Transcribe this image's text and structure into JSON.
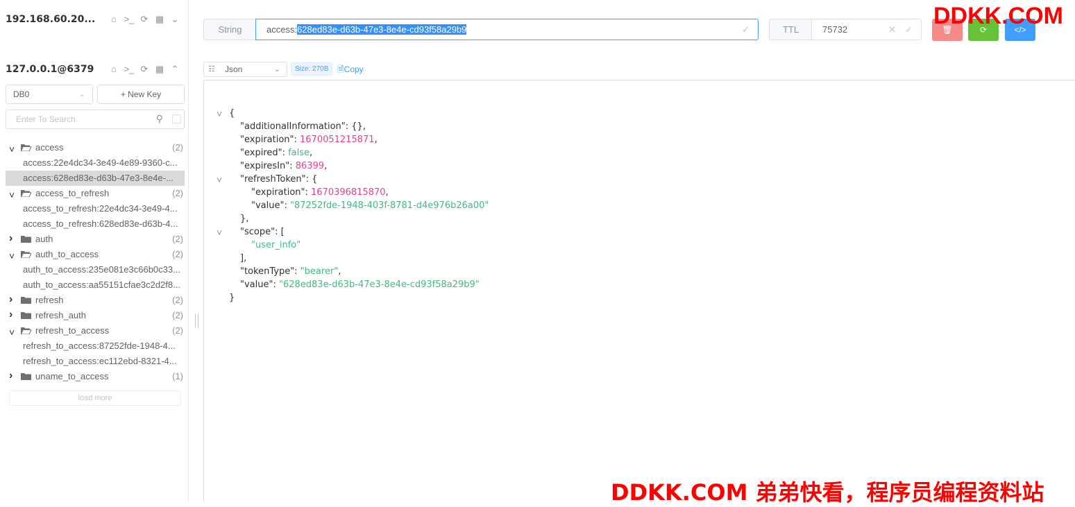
{
  "connections": [
    {
      "name": "192.168.60.20...",
      "icons": [
        "home-icon",
        "terminal-icon",
        "refresh-icon",
        "grid-icon",
        "chevron-down-icon"
      ]
    },
    {
      "name": "127.0.0.1@6379",
      "icons": [
        "home-icon",
        "terminal-icon",
        "refresh-icon",
        "grid-icon",
        "chevron-up-icon"
      ]
    }
  ],
  "sidebar": {
    "db": "DB0",
    "new_key": "+ New Key",
    "search_placeholder": "Enter To Search",
    "load_more": "load more",
    "tree": [
      {
        "type": "folder",
        "label": "access",
        "count": "(2)",
        "open": true
      },
      {
        "type": "leaf",
        "label": "access:22e4dc34-3e49-4e89-9360-c..."
      },
      {
        "type": "leaf",
        "label": "access:628ed83e-d63b-47e3-8e4e-...",
        "selected": true
      },
      {
        "type": "folder",
        "label": "access_to_refresh",
        "count": "(2)",
        "open": true
      },
      {
        "type": "leaf",
        "label": "access_to_refresh:22e4dc34-3e49-4..."
      },
      {
        "type": "leaf",
        "label": "access_to_refresh:628ed83e-d63b-4..."
      },
      {
        "type": "folder",
        "label": "auth",
        "count": "(2)",
        "open": false
      },
      {
        "type": "folder",
        "label": "auth_to_access",
        "count": "(2)",
        "open": true
      },
      {
        "type": "leaf",
        "label": "auth_to_access:235e081e3c66b0c33..."
      },
      {
        "type": "leaf",
        "label": "auth_to_access:aa55151cfae3c2d2f8..."
      },
      {
        "type": "folder",
        "label": "refresh",
        "count": "(2)",
        "open": false
      },
      {
        "type": "folder",
        "label": "refresh_auth",
        "count": "(2)",
        "open": false
      },
      {
        "type": "folder",
        "label": "refresh_to_access",
        "count": "(2)",
        "open": true
      },
      {
        "type": "leaf",
        "label": "refresh_to_access:87252fde-1948-4..."
      },
      {
        "type": "leaf",
        "label": "refresh_to_access:ec112ebd-8321-4..."
      },
      {
        "type": "folder",
        "label": "uname_to_access",
        "count": "(1)",
        "open": false
      }
    ]
  },
  "key_bar": {
    "type": "String",
    "key_prefix": "access:",
    "key_selected": "628ed83e-d63b-47e3-8e4e-cd93f58a29b9",
    "ttl_label": "TTL",
    "ttl_value": "75732"
  },
  "value_bar": {
    "format": "Json",
    "size": "Size: 270B",
    "copy": "Copy"
  },
  "json_lines": [
    {
      "indent": 0,
      "fold": true,
      "parts": [
        {
          "t": "p",
          "v": "{"
        }
      ]
    },
    {
      "indent": 1,
      "parts": [
        {
          "t": "p",
          "v": "\"additionalInformation\": {},"
        }
      ]
    },
    {
      "indent": 1,
      "parts": [
        {
          "t": "p",
          "v": "\"expiration\": "
        },
        {
          "t": "num",
          "v": "1670051215871"
        },
        {
          "t": "p",
          "v": ","
        }
      ]
    },
    {
      "indent": 1,
      "parts": [
        {
          "t": "p",
          "v": "\"expired\": "
        },
        {
          "t": "bool",
          "v": "false"
        },
        {
          "t": "p",
          "v": ","
        }
      ]
    },
    {
      "indent": 1,
      "parts": [
        {
          "t": "p",
          "v": "\"expiresIn\": "
        },
        {
          "t": "num",
          "v": "86399"
        },
        {
          "t": "p",
          "v": ","
        }
      ]
    },
    {
      "indent": 1,
      "fold": true,
      "parts": [
        {
          "t": "p",
          "v": "\"refreshToken\": {"
        }
      ]
    },
    {
      "indent": 2,
      "parts": [
        {
          "t": "p",
          "v": "\"expiration\": "
        },
        {
          "t": "num",
          "v": "1670396815870"
        },
        {
          "t": "p",
          "v": ","
        }
      ]
    },
    {
      "indent": 2,
      "parts": [
        {
          "t": "p",
          "v": "\"value\": "
        },
        {
          "t": "str",
          "v": "\"87252fde-1948-403f-8781-d4e976b26a00\""
        }
      ]
    },
    {
      "indent": 1,
      "parts": [
        {
          "t": "p",
          "v": "},"
        }
      ]
    },
    {
      "indent": 1,
      "fold": true,
      "parts": [
        {
          "t": "p",
          "v": "\"scope\": ["
        }
      ]
    },
    {
      "indent": 2,
      "parts": [
        {
          "t": "str",
          "v": "\"user_info\""
        }
      ]
    },
    {
      "indent": 1,
      "parts": [
        {
          "t": "p",
          "v": "],"
        }
      ]
    },
    {
      "indent": 1,
      "parts": [
        {
          "t": "p",
          "v": "\"tokenType\": "
        },
        {
          "t": "str",
          "v": "\"bearer\""
        },
        {
          "t": "p",
          "v": ","
        }
      ]
    },
    {
      "indent": 1,
      "parts": [
        {
          "t": "p",
          "v": "\"value\": "
        },
        {
          "t": "str",
          "v": "\"628ed83e-d63b-47e3-8e4e-cd93f58a29b9\""
        }
      ]
    },
    {
      "indent": 0,
      "parts": [
        {
          "t": "p",
          "v": "}"
        }
      ]
    }
  ],
  "watermarks": {
    "top": "DDKK.COM",
    "bottom": "DDKK.COM 弟弟快看，程序员编程资料站"
  },
  "colors": {
    "primary": "#409eff",
    "danger": "#f78989",
    "success": "#67c23a",
    "number": "#e83e8c",
    "string": "#42b983",
    "watermark": "#ff0000"
  }
}
